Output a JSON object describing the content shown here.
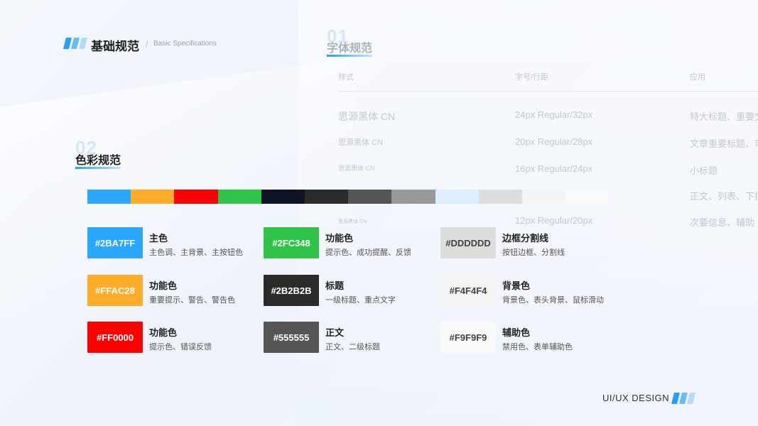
{
  "header": {
    "title": "基础规范",
    "separator": "/",
    "subtitle": "Basic Specifications"
  },
  "font_section": {
    "number": "01",
    "title": "字体规范",
    "columns": [
      "样式",
      "字号/行距",
      "应用"
    ],
    "rows": [
      {
        "style": "思源黑体 CN",
        "size": "24px Regular/32px",
        "usage": "特大标题、重要文"
      },
      {
        "style": "思源黑体 CN",
        "size": "20px Regular/28px",
        "usage": "文章重要标题、可"
      },
      {
        "style": "思源黑体 CN",
        "size": "16px Regular/24px",
        "usage": "小标题"
      },
      {
        "style": "",
        "size": "",
        "usage": "正文、列表、下拉"
      },
      {
        "style": "思源黑体 CN",
        "size": "12px Regular/20px",
        "usage": "次要信息、辅助"
      }
    ]
  },
  "color_section": {
    "number": "02",
    "title": "色彩规范",
    "palette": [
      "#2BA7FF",
      "#FFAC28",
      "#FF0000",
      "#2FC348",
      "#0C1425",
      "#2B2B2B",
      "#555555",
      "#999999",
      "#DDEFFF",
      "#DDDDDD",
      "#F4F4F4",
      "#F9F9F9"
    ],
    "swatches": [
      {
        "hex": "#2BA7FF",
        "text_color": "#FFFFFF",
        "name": "主色",
        "desc": "主色调、主背景、主按钮色"
      },
      {
        "hex": "#2FC348",
        "text_color": "#FFFFFF",
        "name": "功能色",
        "desc": "提示色、成功提醒、反馈"
      },
      {
        "hex": "#DDDDDD",
        "text_color": "#444444",
        "name": "边框分割线",
        "desc": "按钮边框、分割线"
      },
      {
        "hex": "#FFAC28",
        "text_color": "#FFFFFF",
        "name": "功能色",
        "desc": "重要提示、警告、警告色"
      },
      {
        "hex": "#2B2B2B",
        "text_color": "#FFFFFF",
        "name": "标题",
        "desc": "一级标题、重点文字"
      },
      {
        "hex": "#F4F4F4",
        "text_color": "#444444",
        "name": "背景色",
        "desc": "背景色、表头背景、鼠标滑动"
      },
      {
        "hex": "#FF0000",
        "text_color": "#FFFFFF",
        "name": "功能色",
        "desc": "提示色、错误反馈"
      },
      {
        "hex": "#555555",
        "text_color": "#FFFFFF",
        "name": "正文",
        "desc": "正文、二级标题"
      },
      {
        "hex": "#F9F9F9",
        "text_color": "#444444",
        "name": "辅助色",
        "desc": "禁用色、表单辅助色"
      }
    ]
  },
  "footer": {
    "text": "UI/UX DESIGN"
  }
}
